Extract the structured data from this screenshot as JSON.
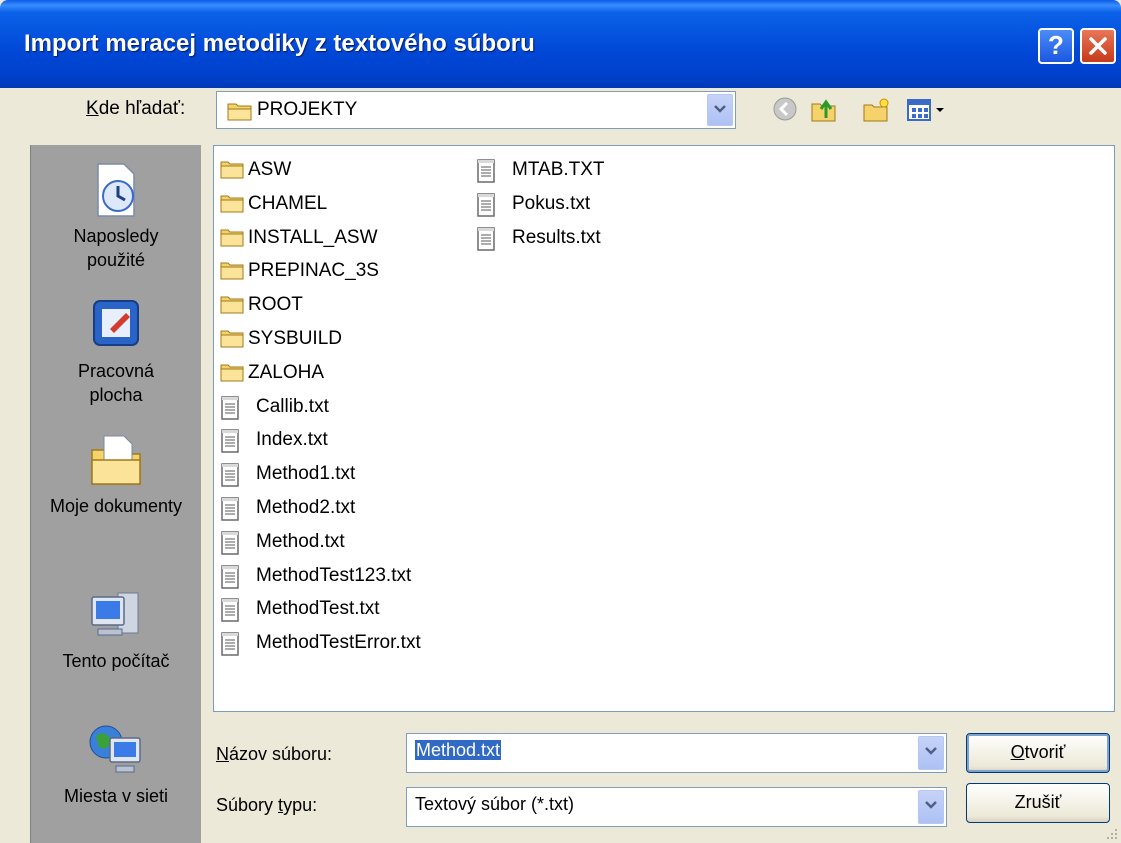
{
  "window": {
    "title": "Import meracej metodiky z textového súboru",
    "help_label": "?",
    "close_label": "×"
  },
  "lookin": {
    "label_underlined": "K",
    "label_rest": "de hľadať:",
    "value": "PROJEKTY"
  },
  "places": [
    {
      "label_line1": "Naposledy",
      "label_line2": "použité",
      "icon": "recent-documents-icon"
    },
    {
      "label_line1": "Pracovná",
      "label_line2": "plocha",
      "icon": "desktop-icon"
    },
    {
      "label_line1": "Moje dokumenty",
      "label_line2": "",
      "icon": "my-documents-icon"
    },
    {
      "label_line1": "Tento počítač",
      "label_line2": "",
      "icon": "my-computer-icon"
    },
    {
      "label_line1": "Miesta v sieti",
      "label_line2": "",
      "icon": "network-places-icon"
    }
  ],
  "files_col1": [
    {
      "name": "ASW",
      "type": "folder"
    },
    {
      "name": "CHAMEL",
      "type": "folder"
    },
    {
      "name": "INSTALL_ASW",
      "type": "folder"
    },
    {
      "name": "PREPINAC_3S",
      "type": "folder"
    },
    {
      "name": "ROOT",
      "type": "folder"
    },
    {
      "name": "SYSBUILD",
      "type": "folder"
    },
    {
      "name": "ZALOHA",
      "type": "folder"
    },
    {
      "name": "Callib.txt",
      "type": "text"
    },
    {
      "name": "Index.txt",
      "type": "text"
    },
    {
      "name": "Method1.txt",
      "type": "text"
    },
    {
      "name": "Method2.txt",
      "type": "text"
    },
    {
      "name": "Method.txt",
      "type": "text"
    },
    {
      "name": "MethodTest123.txt",
      "type": "text"
    },
    {
      "name": "MethodTest.txt",
      "type": "text"
    },
    {
      "name": "MethodTestError.txt",
      "type": "text"
    }
  ],
  "files_col2": [
    {
      "name": "MTAB.TXT",
      "type": "text"
    },
    {
      "name": "Pokus.txt",
      "type": "text"
    },
    {
      "name": "Results.txt",
      "type": "text"
    }
  ],
  "filename": {
    "label_underlined": "N",
    "label_rest": "ázov súboru:",
    "value": "Method.txt"
  },
  "filetype": {
    "label_pre": "Súbory ",
    "label_underlined": "t",
    "label_rest": "ypu:",
    "value": "Textový súbor (*.txt)"
  },
  "buttons": {
    "open_underlined": "O",
    "open_rest": "tvoriť",
    "cancel": "Zrušiť"
  }
}
